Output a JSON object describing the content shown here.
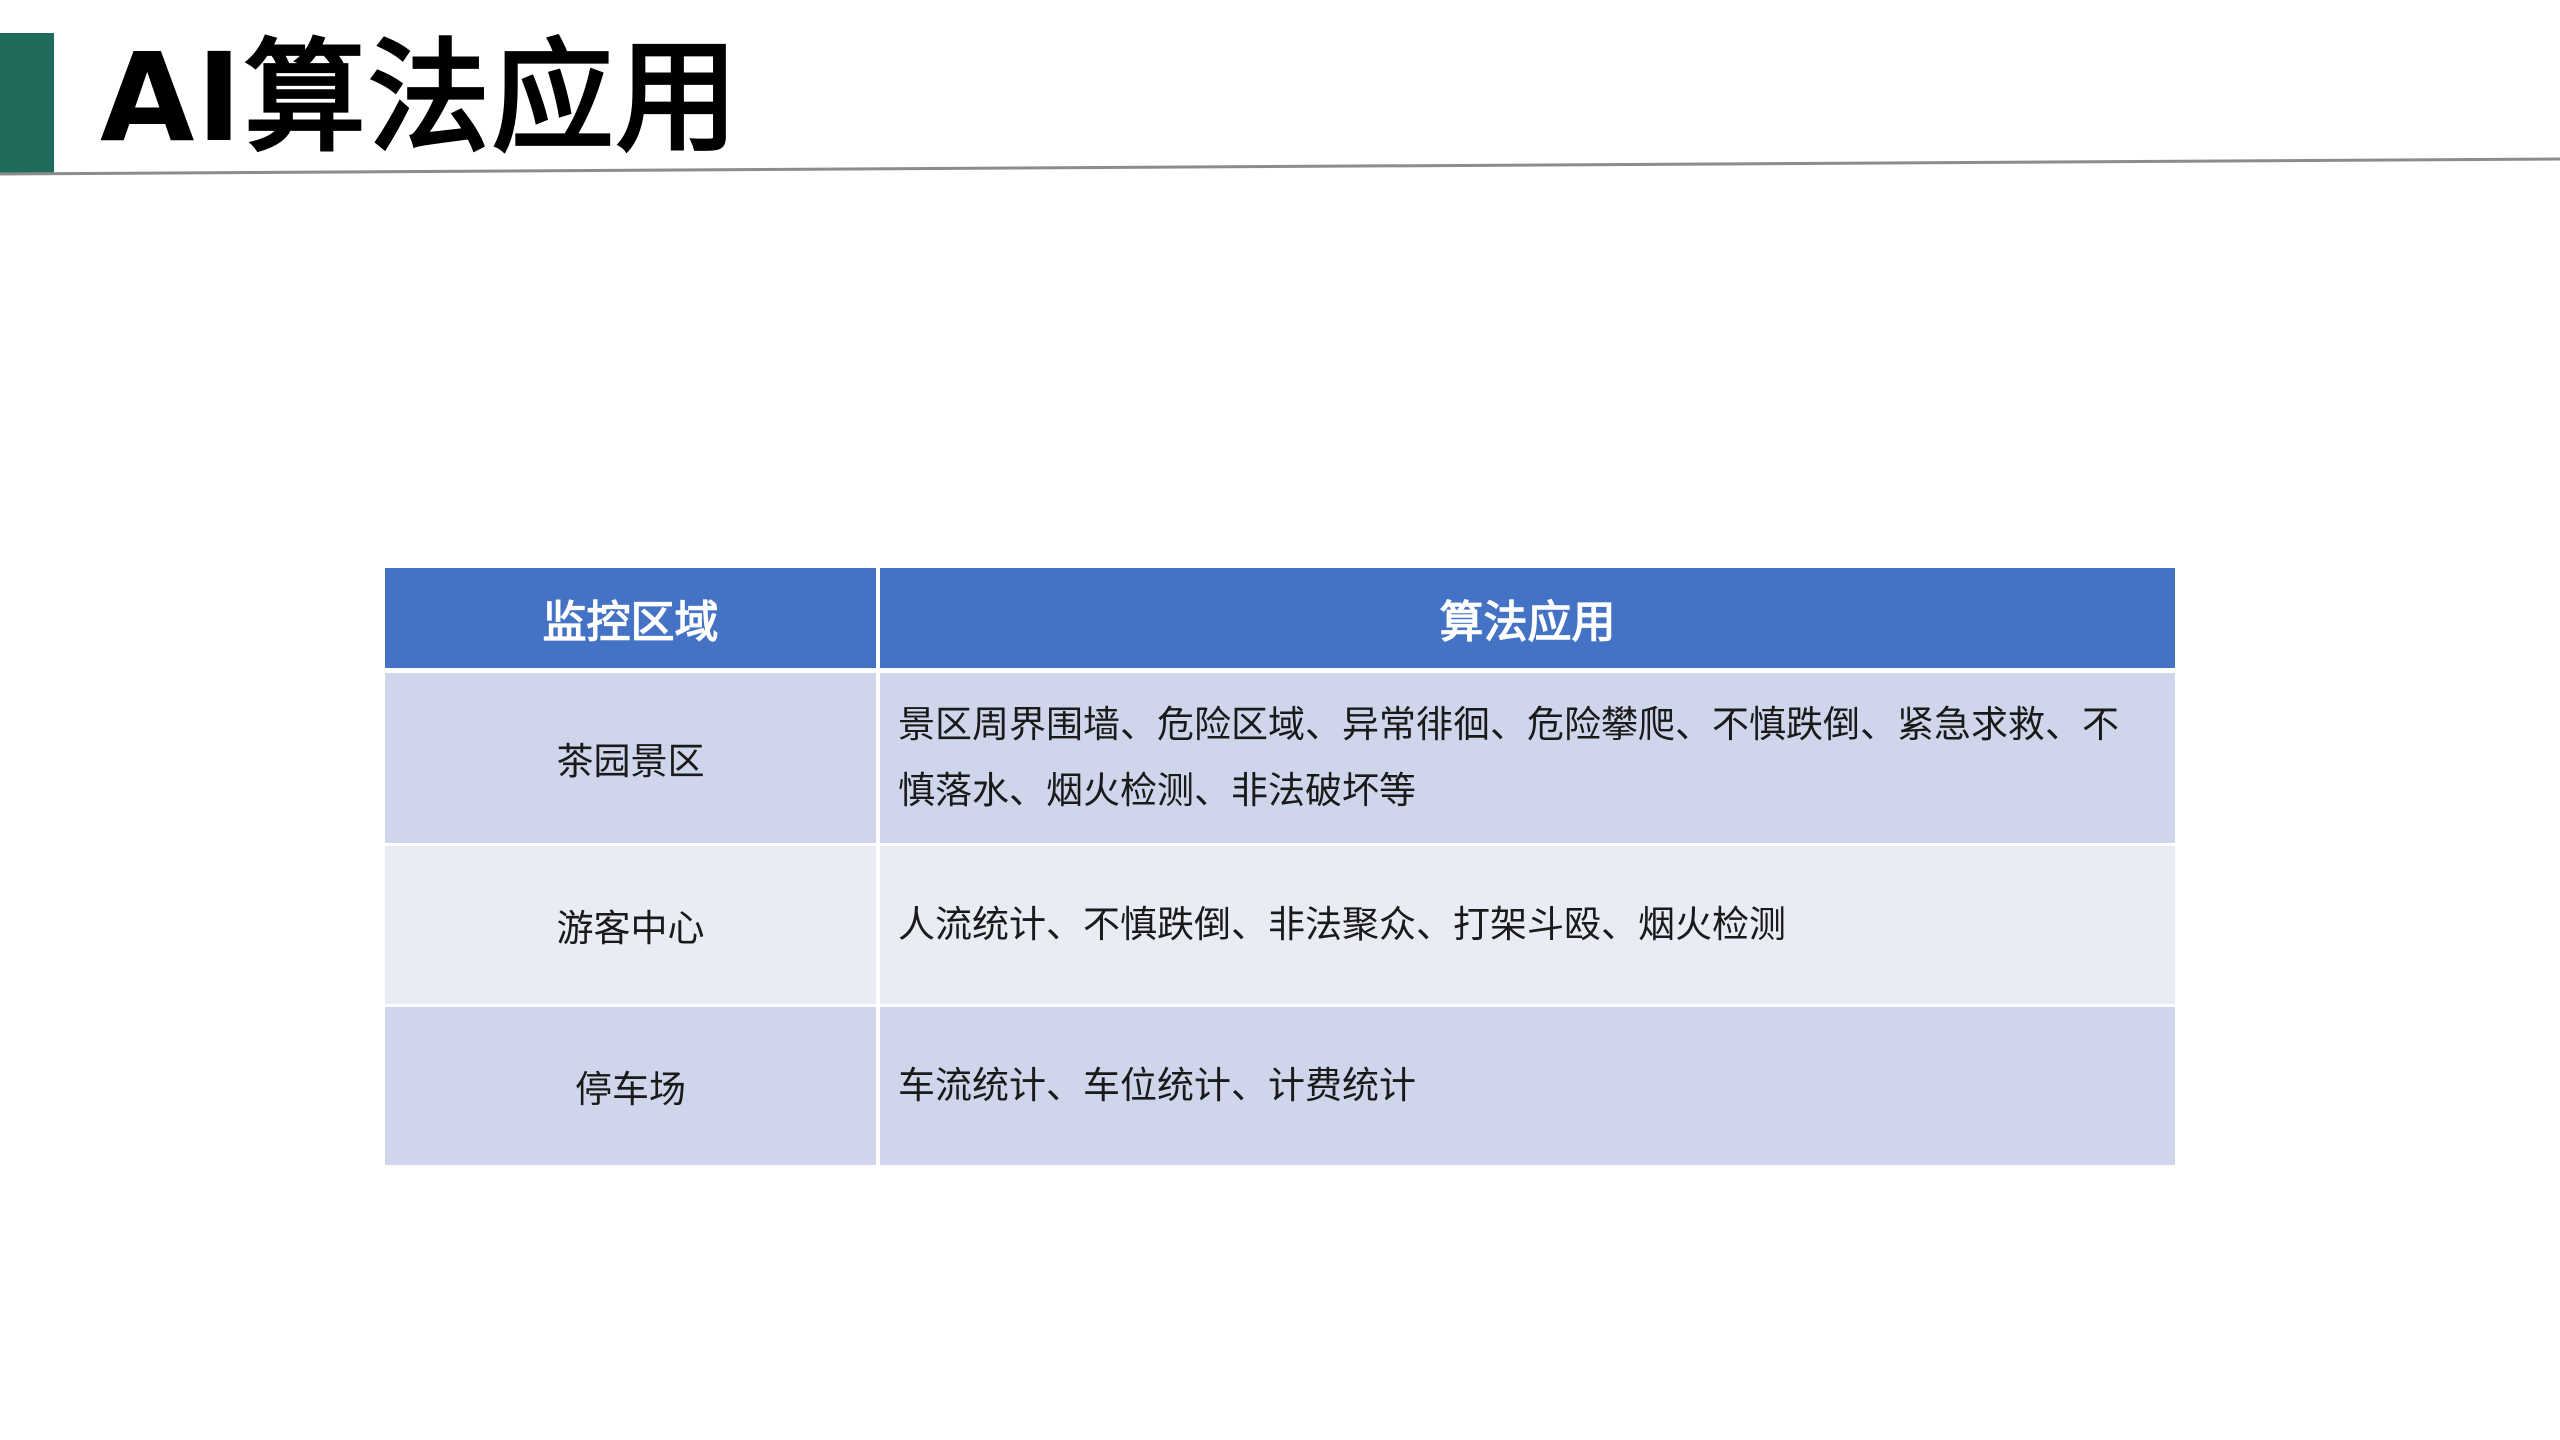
{
  "slide": {
    "title": "AI算法应用",
    "accent_color": "#1e6b5c"
  },
  "table": {
    "header_color": "#4472c4",
    "headers": [
      "监控区域",
      "算法应用"
    ],
    "rows": [
      {
        "area": "茶园景区",
        "algorithms": "景区周界围墙、危险区域、异常徘徊、危险攀爬、不慎跌倒、紧急求救、不慎落水、烟火检测、非法破坏等"
      },
      {
        "area": "游客中心",
        "algorithms": "人流统计、不慎跌倒、非法聚众、打架斗殴、烟火检测"
      },
      {
        "area": "停车场",
        "algorithms": "车流统计、车位统计、计费统计"
      }
    ]
  }
}
